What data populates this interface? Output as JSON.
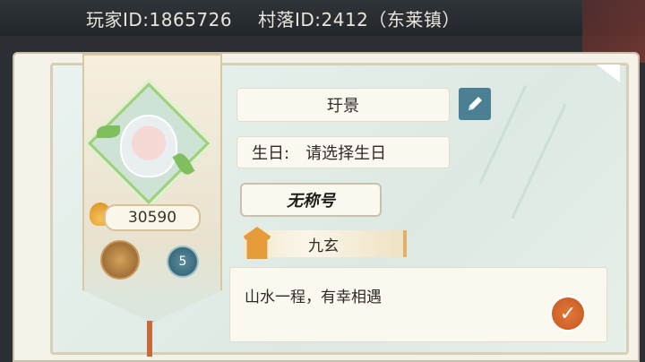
{
  "header": {
    "player_id": "玩家ID:1865726",
    "village_id": "村落ID:2412（东莱镇）"
  },
  "profile": {
    "score": "30590",
    "level": "5",
    "name": "玗景",
    "birthday_label": "生日:",
    "birthday_value": "请选择生日",
    "title": "无称号",
    "clan": "九玄",
    "signature": "山水一程，有幸相遇"
  },
  "icons": {
    "edit": "pencil-icon",
    "confirm": "check-icon",
    "score": "flame-icon",
    "clan": "pavilion-icon",
    "medal": "medal-icon",
    "level": "level-badge-icon"
  },
  "colors": {
    "accent_teal": "#4b7f93",
    "confirm_orange": "#d9662b",
    "page_bg": "#e4efe9"
  }
}
